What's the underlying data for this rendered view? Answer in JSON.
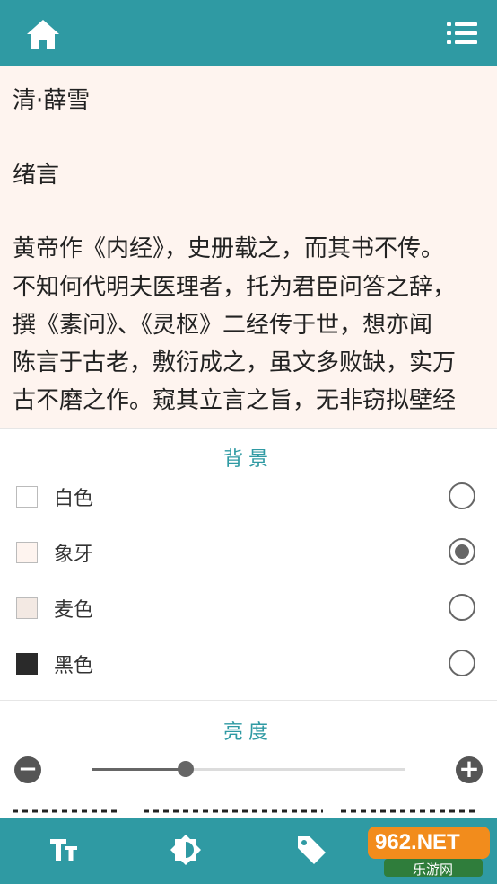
{
  "header": {
    "home_icon": "home-icon",
    "menu_icon": "list-icon"
  },
  "reader": {
    "lines": [
      "清·薛雪",
      "",
      "绪言",
      "",
      "黄帝作《内经》，史册载之，而其书不传。",
      "不知何代明夫医理者，托为君臣问答之辞，",
      "撰《素问》、《灵枢》二经传于世，想亦闻",
      "陈言于古老，敷衍成之，虽文多败缺，实万",
      "古不磨之作。窥其立言之旨，无非窃拟壁经"
    ],
    "background": "#fef4ef"
  },
  "background_section": {
    "title": "背景",
    "options": [
      {
        "label": "白色",
        "swatch": "#ffffff",
        "selected": false
      },
      {
        "label": "象牙",
        "swatch": "#fef4ef",
        "selected": true
      },
      {
        "label": "麦色",
        "swatch": "#f3e9e3",
        "selected": false
      },
      {
        "label": "黑色",
        "swatch": "#2a2a2a",
        "selected": false
      }
    ]
  },
  "brightness_section": {
    "title": "亮度",
    "minus": "−",
    "plus": "+",
    "value": 0.3
  },
  "bottom_bar": {
    "icons": [
      "font-size-icon",
      "brightness-icon",
      "tag-icon",
      "next-icon"
    ],
    "watermark_top": "962.NET",
    "watermark_bottom": "乐游网"
  },
  "colors": {
    "accent": "#2f9aa3"
  }
}
